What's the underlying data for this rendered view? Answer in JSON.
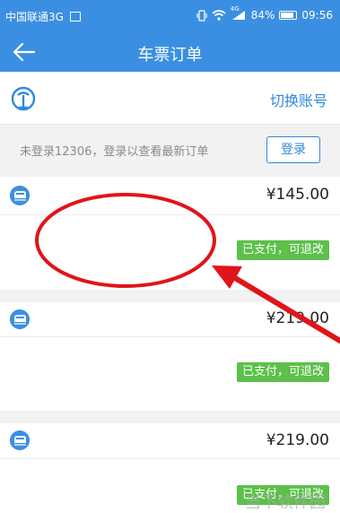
{
  "status_bar": {
    "carrier": "中国联通3G",
    "signal_type": "4G",
    "battery": "84%",
    "time": "09:56"
  },
  "app_bar": {
    "title": "车票订单"
  },
  "account": {
    "switch_label": "切换账号"
  },
  "login": {
    "hint": "未登录12306，登录以查看最新订单",
    "button_label": "登录"
  },
  "orders": [
    {
      "price": "¥145.00",
      "status": "已支付，可退改"
    },
    {
      "price": "¥219.00",
      "status": "已支付，可退改"
    },
    {
      "price": "¥219.00",
      "status": "已支付，可退改"
    }
  ],
  "watermark": "当下软件园",
  "colors": {
    "brand_blue": "#3b8fe2",
    "link_blue": "#2f87e0",
    "status_green": "#5cc04a",
    "annotation_red": "#e0141b"
  }
}
